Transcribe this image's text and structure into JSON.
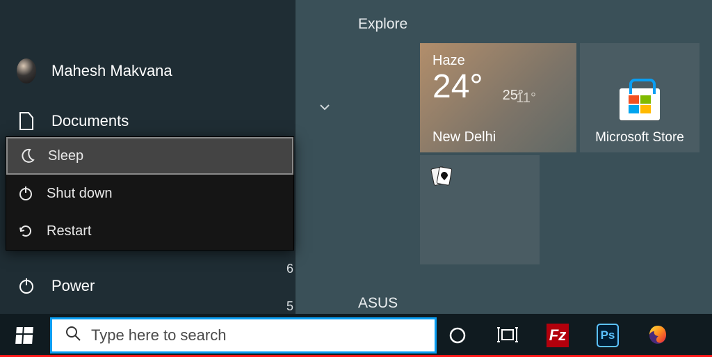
{
  "user": {
    "name": "Mahesh Makvana"
  },
  "rail": {
    "documents": "Documents",
    "power": "Power"
  },
  "power_menu": {
    "sleep": "Sleep",
    "shutdown": "Shut down",
    "restart": "Restart"
  },
  "groups": {
    "explore": "Explore",
    "asus": "ASUS"
  },
  "tiles": {
    "weather": {
      "condition": "Haze",
      "temp": "24°",
      "high": "25°",
      "low": "11°",
      "city": "New Delhi"
    },
    "store": {
      "label": "Microsoft Store"
    }
  },
  "taskbar": {
    "search_placeholder": "Type here to search",
    "icons": {
      "cortana": "cortana-icon",
      "taskview": "task-view-icon",
      "filezilla": "filezilla-icon",
      "photoshop": "photoshop-icon",
      "firefox": "firefox-icon"
    }
  },
  "stray": {
    "six": "6",
    "five": "5"
  },
  "colors": {
    "accent": "#0a9ef2",
    "red": "#ff1a1a"
  }
}
